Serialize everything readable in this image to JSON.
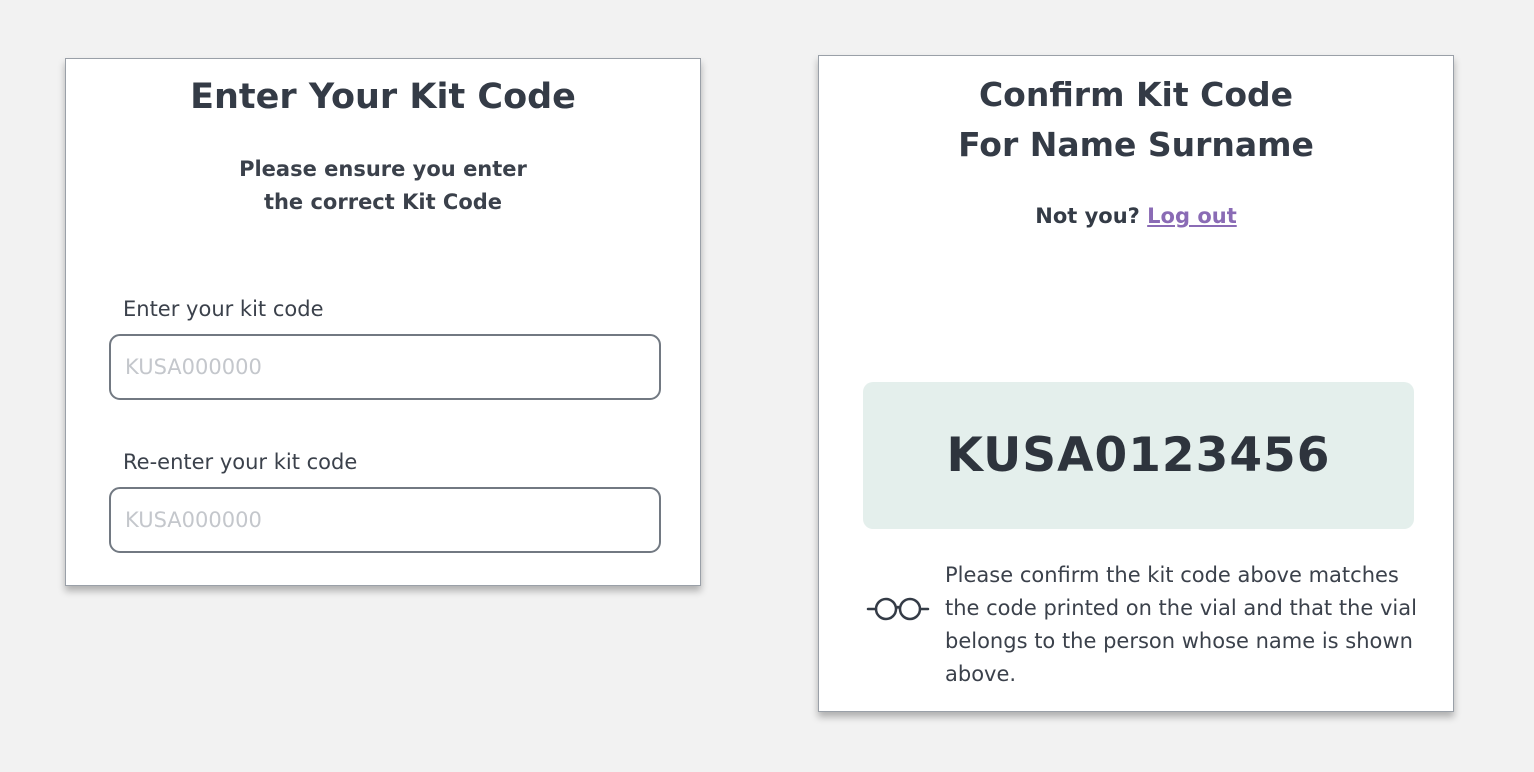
{
  "enter_card": {
    "title": "Enter Your Kit Code",
    "subtitle_line1": "Please ensure you enter",
    "subtitle_line2": "the correct Kit Code",
    "kit_code_label": "Enter your kit code",
    "kit_code_placeholder": "KUSA000000",
    "reenter_label": "Re-enter your kit code",
    "reenter_placeholder": "KUSA000000"
  },
  "confirm_card": {
    "title_line1": "Confirm Kit Code",
    "title_line2": "For Name Surname",
    "not_you_text": "Not you?",
    "logout_label": "Log out",
    "kit_code": "KUSA0123456",
    "confirm_message": "Please confirm the kit code above matches the code printed on the vial and that the vial belongs to the person whose name is shown above.",
    "icon": "glasses-icon"
  },
  "colors": {
    "background": "#f2f2f2",
    "text": "#343b46",
    "link": "#8a6bb5",
    "code_box": "#e4efec"
  }
}
